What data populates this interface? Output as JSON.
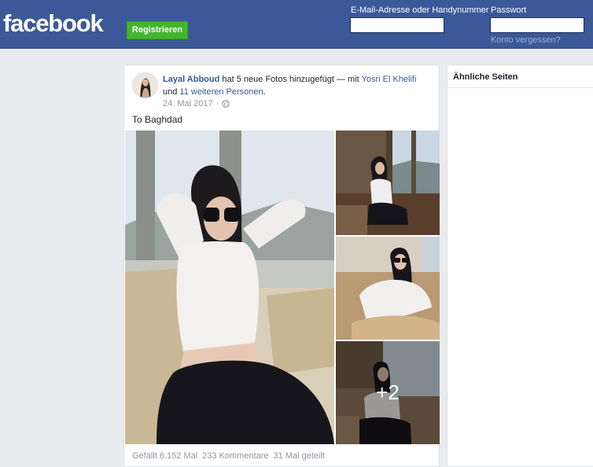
{
  "header": {
    "logo": "facebook",
    "register_label": "Registrieren",
    "email_label": "E-Mail-Adresse oder Handynummer",
    "email_value": "",
    "password_label": "Passwort",
    "password_value": "",
    "forgot_label": "Konto vergessen?"
  },
  "post": {
    "author": "Layal Abboud",
    "action_text": "hat 5 neue Fotos hinzugefügt — mit",
    "tagged_person": "Yosri El Khelifi",
    "and_text": "und",
    "others": "11 weiteren Personen",
    "period": ".",
    "date": "24. Mai 2017",
    "separator": "·",
    "privacy_icon": "globe-icon",
    "caption": "To Baghdad",
    "more_photos": "+2",
    "likes": "Gefällt 6.152 Mal",
    "comments": "233 Kommentare",
    "shares": "31 Mal geteilt"
  },
  "sidebar": {
    "title": "Ähnliche Seiten"
  },
  "colors": {
    "brand_blue": "#3b5998",
    "register_green": "#42b72a",
    "link_blue": "#365899",
    "meta_gray": "#90949c",
    "background": "#e9ebee"
  }
}
